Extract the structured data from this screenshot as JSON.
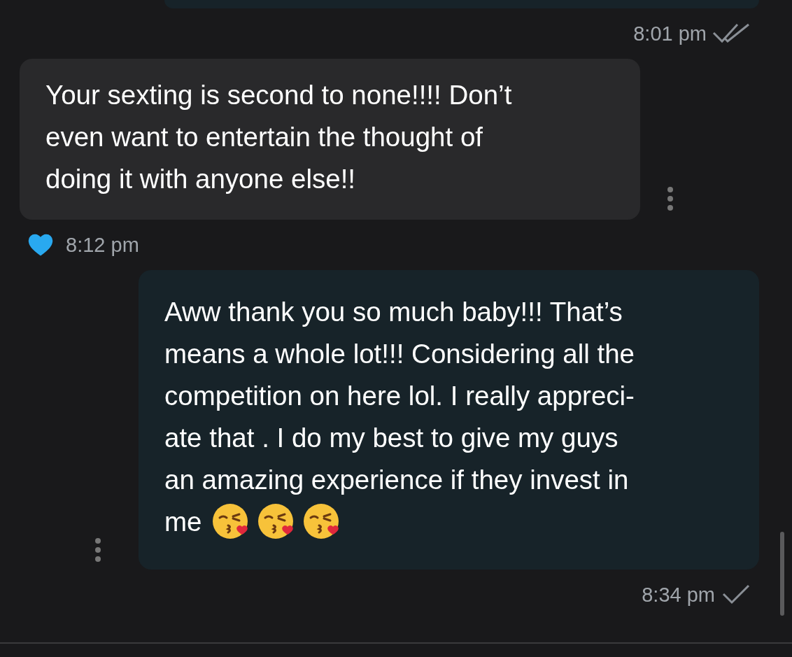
{
  "messages": [
    {
      "kind": "sent",
      "cut": true,
      "time": "8:01 pm",
      "read": true
    },
    {
      "kind": "received",
      "lines": [
        "Your sexting is second to none!!!! Don’t",
        "even want to entertain the thought of",
        "doing it with anyone else!!"
      ],
      "liked": true,
      "time": "8:12 pm"
    },
    {
      "kind": "sent",
      "lines": [
        "Aww thank you so much baby!!! That’s",
        "means a whole lot!!! Considering all the",
        "competition on here lol. I really appreci-",
        "ate that . I do my best to give my guys",
        "an amazing experience if they invest in",
        "me"
      ],
      "end_icons": [
        {
          "kind": "kiss"
        },
        {
          "kind": "kiss"
        },
        {
          "kind": "kiss"
        }
      ],
      "time": "8:34 pm",
      "read": false
    }
  ]
}
